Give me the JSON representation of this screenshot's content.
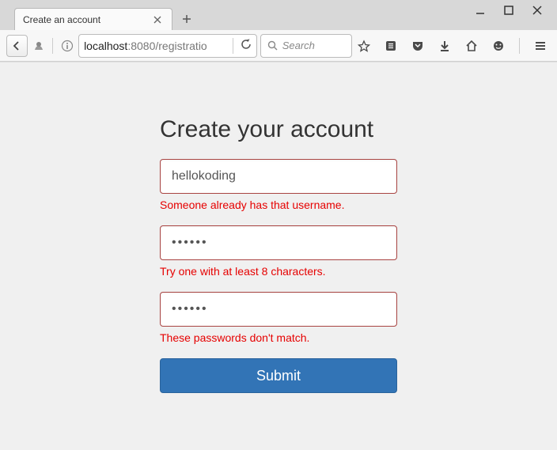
{
  "window": {
    "controls": [
      "minimize",
      "maximize",
      "close"
    ]
  },
  "tab": {
    "title": "Create an account"
  },
  "toolbar": {
    "url_host": "localhost",
    "url_path": ":8080/registratio",
    "search_placeholder": "Search"
  },
  "form": {
    "title": "Create your account",
    "username": {
      "value": "hellokoding",
      "error": "Someone already has that username."
    },
    "password": {
      "value": "••••••",
      "error": "Try one with at least 8 characters."
    },
    "confirm": {
      "value": "••••••",
      "error": "These passwords don't match."
    },
    "submit_label": "Submit"
  }
}
